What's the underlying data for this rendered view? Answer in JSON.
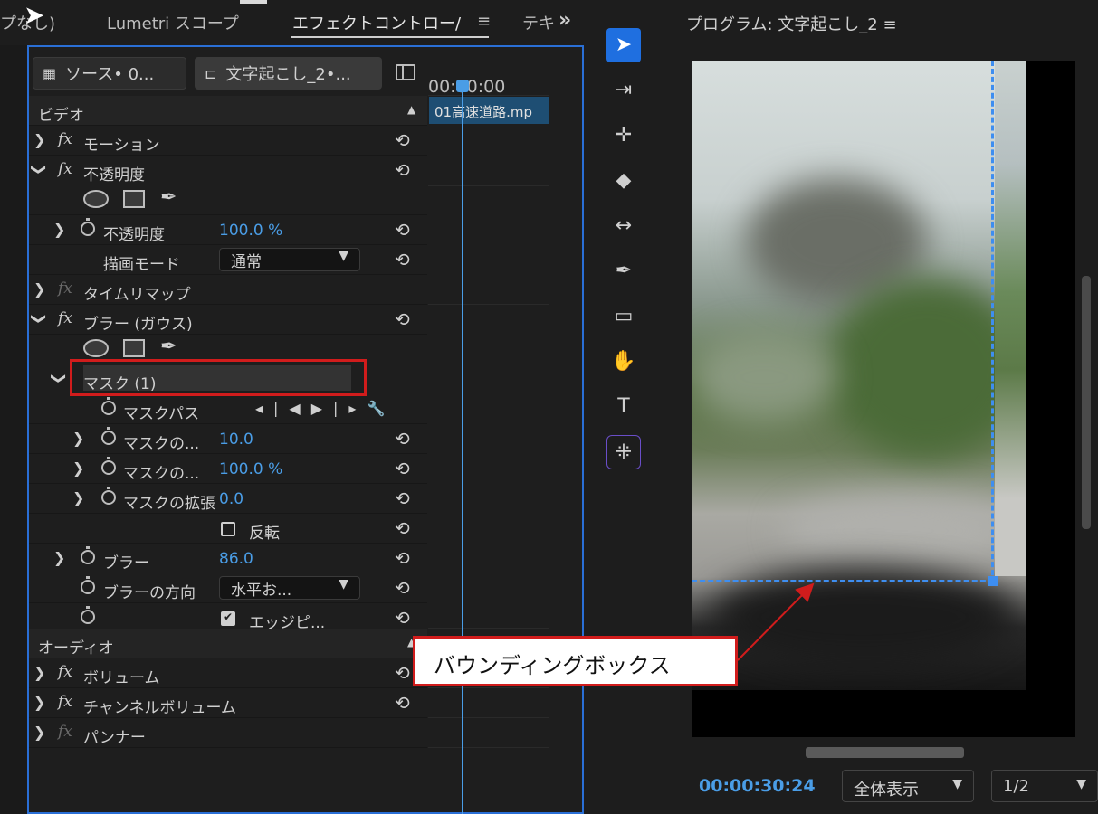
{
  "tabs": {
    "tab1": "プなし)",
    "tab2": "Lumetri スコープ",
    "tab3": "エフェクトコントロー/",
    "tab4": "テキ"
  },
  "source": {
    "source_btn": "ソース• 0...",
    "seq_btn": "文字起こし_2•..."
  },
  "timeline": {
    "time": "00:00:00",
    "clip": "01高速道路.mp"
  },
  "sections": {
    "video": "ビデオ",
    "audio": "オーディオ"
  },
  "rows": {
    "motion": "モーション",
    "opacity": "不透明度",
    "opacity_param": "不透明度",
    "opacity_val": "100.0 %",
    "blend_mode": "描画モード",
    "blend_val": "通常",
    "time_remap": "タイムリマップ",
    "gauss": "ブラー (ガウス)",
    "mask": "マスク (1)",
    "mask_path": "マスクパス",
    "mask_feather": "マスクの...",
    "mask_feather_val": "10.0",
    "mask_opacity": "マスクの...",
    "mask_opacity_val": "100.0 %",
    "mask_expansion": "マスクの拡張",
    "mask_expansion_val": "0.0",
    "invert": "反転",
    "blur": "ブラー",
    "blur_val": "86.0",
    "blur_dir": "ブラーの方向",
    "blur_dir_val": "水平お...",
    "edge": "エッジピ...",
    "volume": "ボリューム",
    "channel_volume": "チャンネルボリューム",
    "panner": "パンナー"
  },
  "program": {
    "title": "プログラム: 文字起こし_2",
    "timecode": "00:00:30:24",
    "zoom": "全体表示",
    "resolution": "1/2"
  },
  "callout": "バウンディングボックス",
  "colors": {
    "accent": "#4a9de6",
    "highlight_red": "#d11c1c",
    "bbox": "#3e8ef0"
  }
}
